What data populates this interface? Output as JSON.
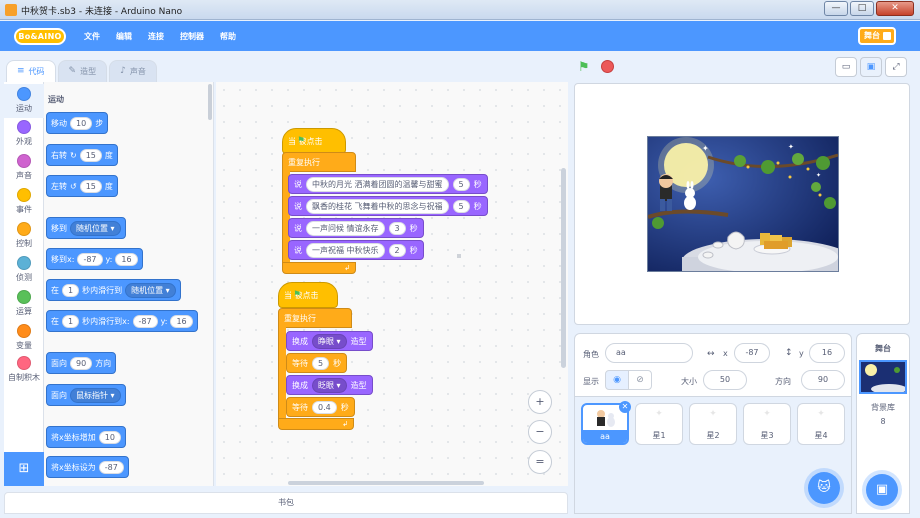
{
  "window": {
    "title": "中秋贺卡.sb3 - 未连接 - Arduino Nano",
    "min_glyph": "—",
    "max_glyph": "□",
    "close_glyph": "✕"
  },
  "menubar": {
    "logo": "Bo&AINO",
    "items": [
      "文件",
      "编辑",
      "连接",
      "控制器",
      "帮助"
    ],
    "stage_mode_label": "舞台"
  },
  "tabs": [
    {
      "label": "代码",
      "icon": "code-icon"
    },
    {
      "label": "造型",
      "icon": "brush-icon"
    },
    {
      "label": "声音",
      "icon": "speaker-icon"
    }
  ],
  "categories": [
    {
      "label": "运动",
      "color": "#4c97ff"
    },
    {
      "label": "外观",
      "color": "#9966ff"
    },
    {
      "label": "声音",
      "color": "#cf63cf"
    },
    {
      "label": "事件",
      "color": "#ffbf00"
    },
    {
      "label": "控制",
      "color": "#ffab19"
    },
    {
      "label": "侦测",
      "color": "#5cb1d6"
    },
    {
      "label": "运算",
      "color": "#59c059"
    },
    {
      "label": "变量",
      "color": "#ff8c1a"
    },
    {
      "label": "自制积木",
      "color": "#ff6680"
    }
  ],
  "palette": {
    "heading": "运动",
    "blocks": {
      "move": {
        "a": "移动",
        "n": "10",
        "b": "步"
      },
      "turn_right": {
        "a": "右转",
        "n": "15",
        "b": "度"
      },
      "turn_left": {
        "a": "左转",
        "n": "15",
        "b": "度"
      },
      "goto": {
        "a": "移到",
        "d": "随机位置"
      },
      "goto_xy": {
        "a": "移到x:",
        "x": "-87",
        "b": "y:",
        "y": "16"
      },
      "glide": {
        "a": "在",
        "n": "1",
        "b": "秒内滑行到",
        "d": "随机位置"
      },
      "glide_xy": {
        "a": "在",
        "n": "1",
        "b": "秒内滑行到x:",
        "x": "-87",
        "c": "y:",
        "y": "16"
      },
      "point_dir": {
        "a": "面向",
        "n": "90",
        "b": "方向"
      },
      "point_towards": {
        "a": "面向",
        "d": "鼠标指针"
      },
      "change_x": {
        "a": "将x坐标增加",
        "n": "10"
      },
      "set_x": {
        "a": "将x坐标设为",
        "n": "-87"
      }
    }
  },
  "script1": {
    "hat": "当 被点击",
    "forever": "重复执行",
    "says": [
      {
        "say": "说",
        "text": "中秋的月光  洒满着团圆的温馨与甜蜜",
        "secs": "5",
        "unit": "秒"
      },
      {
        "say": "说",
        "text": "飘香的桂花  飞舞着中秋的思念与祝福",
        "secs": "5",
        "unit": "秒"
      },
      {
        "say": "说",
        "text": "一声问候  情谊永存",
        "secs": "3",
        "unit": "秒"
      },
      {
        "say": "说",
        "text": "一声祝福  中秋快乐",
        "secs": "2",
        "unit": "秒"
      }
    ]
  },
  "script2": {
    "hat": "当 被点击",
    "forever": "重复执行",
    "switch1": {
      "a": "换成",
      "d": "睁眼",
      "b": "造型"
    },
    "wait1": {
      "a": "等待",
      "n": "5",
      "b": "秒"
    },
    "switch2": {
      "a": "换成",
      "d": "眨眼",
      "b": "造型"
    },
    "wait2": {
      "a": "等待",
      "n": "0.4",
      "b": "秒"
    }
  },
  "backpack_label": "书包",
  "zoom": {
    "in": "+",
    "out": "−",
    "reset": "="
  },
  "sprite_info": {
    "sprite_label": "角色",
    "sprite_name": "aa",
    "x_label": "x",
    "x": "-87",
    "y_label": "y",
    "y": "16",
    "show_label": "显示",
    "size_label": "大小",
    "size": "50",
    "direction_label": "方向",
    "direction": "90"
  },
  "sprites": [
    "aa",
    "星1",
    "星2",
    "星3",
    "星4"
  ],
  "stage_panel": {
    "label": "舞台",
    "backdrops_label": "背景库",
    "backdrops_count": "8"
  },
  "colors": {
    "accent": "#4c97ff",
    "motion": "#4c97ff",
    "events": "#ffbf00",
    "control": "#ffab19",
    "looks": "#9966ff"
  }
}
